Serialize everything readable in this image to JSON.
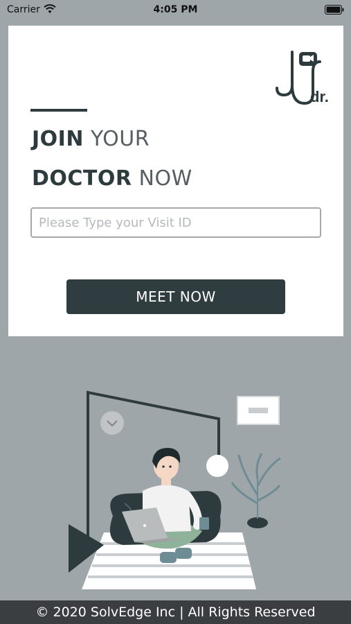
{
  "status_bar": {
    "carrier": "Carrier",
    "time": "4:05 PM"
  },
  "header": {
    "title_line1_strong": "JOIN",
    "title_line1_light": "YOUR",
    "title_line2_strong": "DOCTOR",
    "title_line2_light": "NOW"
  },
  "logo": {
    "text": "dr."
  },
  "form": {
    "visit_id_placeholder": "Please Type your Visit ID",
    "visit_id_value": "",
    "meet_button_label": "MEET NOW"
  },
  "footer": {
    "text": "© 2020 SolvEdge Inc | All Rights Reserved"
  },
  "colors": {
    "background": "#9fa6a9",
    "primary": "#2f3c40",
    "footer": "#3b3e40"
  }
}
